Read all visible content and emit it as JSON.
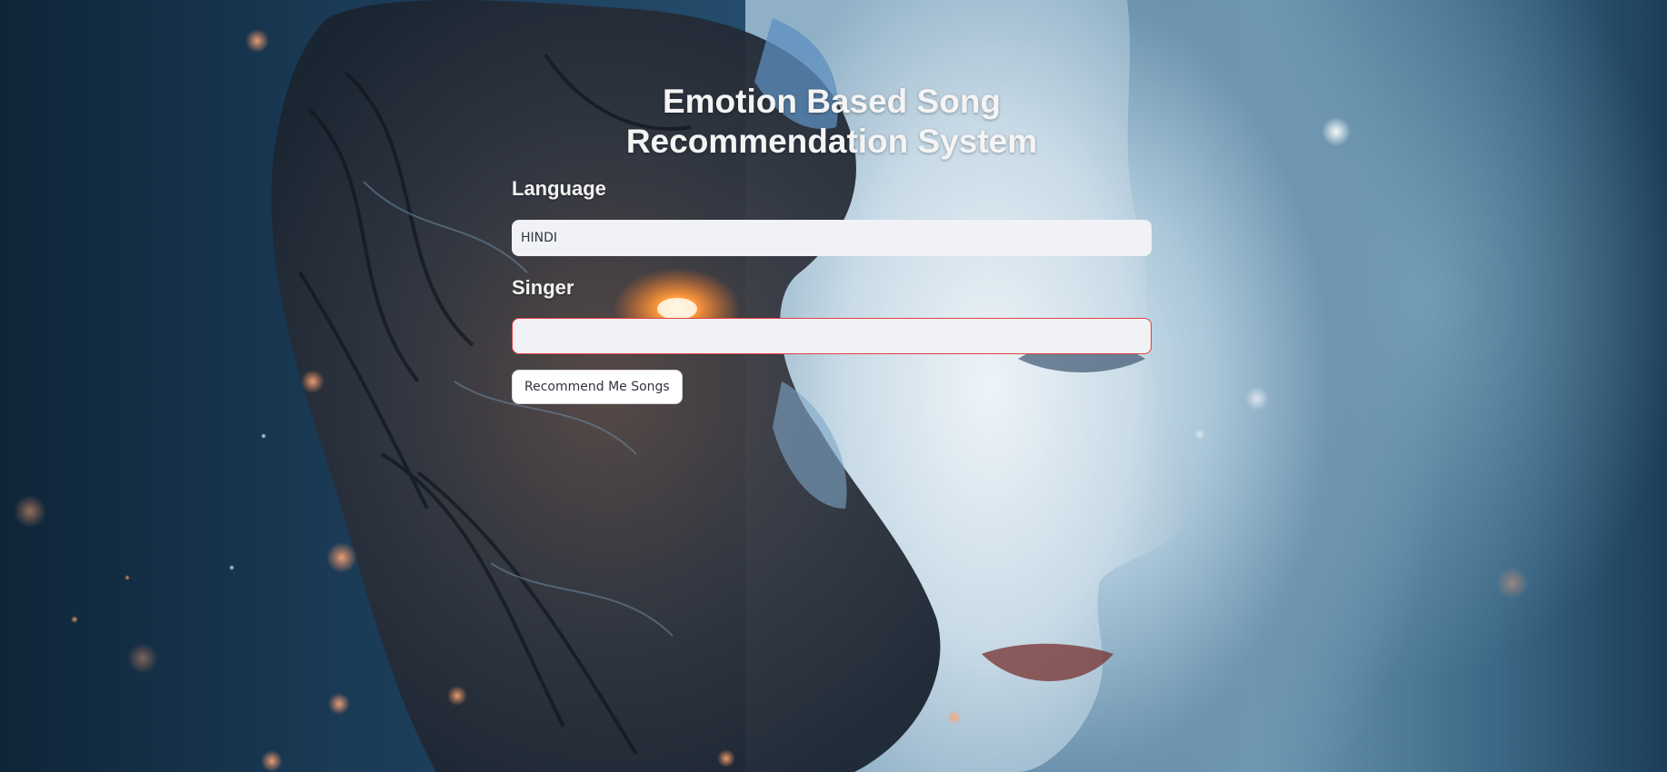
{
  "header": {
    "title_line1": "Emotion Based Song",
    "title_line2": "Recommendation System"
  },
  "form": {
    "language_label": "Language",
    "language_value": "HINDI",
    "singer_label": "Singer",
    "singer_value": "",
    "submit_label": "Recommend Me Songs"
  },
  "colors": {
    "input_background": "#f0f2f6",
    "singer_input_border": "#e0403d",
    "title_text": "#f4f4f4"
  }
}
